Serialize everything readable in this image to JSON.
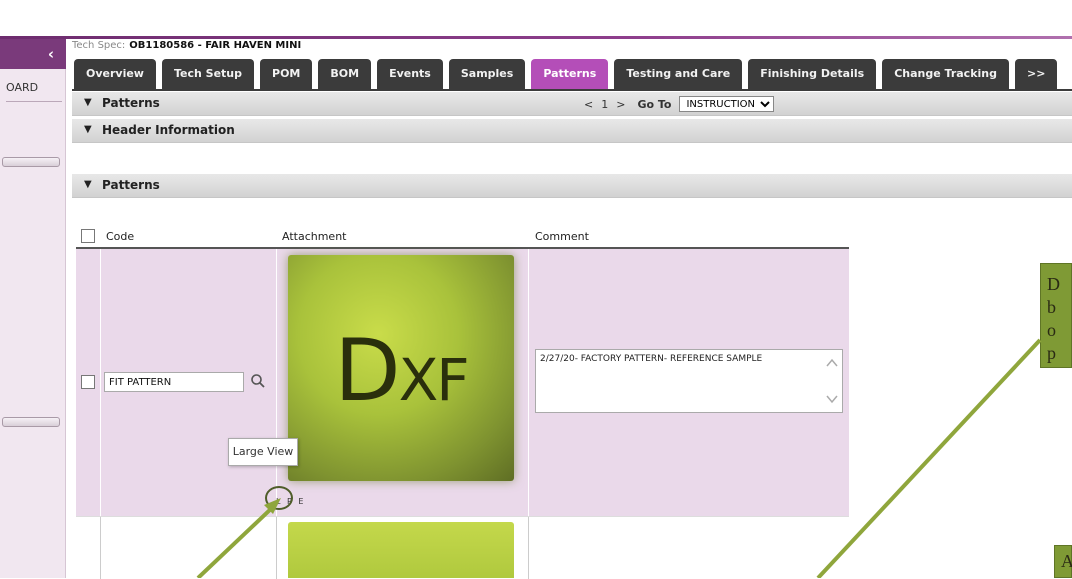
{
  "sidebar": {
    "collapse_glyph": "‹",
    "label": "OARD"
  },
  "header": {
    "techspec_prefix": "Tech Spec:",
    "techspec_value": "OB1180586 - FAIR HAVEN MINI"
  },
  "tabs": [
    {
      "label": "Overview",
      "active": false
    },
    {
      "label": "Tech Setup",
      "active": false
    },
    {
      "label": "POM",
      "active": false
    },
    {
      "label": "BOM",
      "active": false
    },
    {
      "label": "Events",
      "active": false
    },
    {
      "label": "Samples",
      "active": false
    },
    {
      "label": "Patterns",
      "active": true
    },
    {
      "label": "Testing and Care",
      "active": false
    },
    {
      "label": "Finishing Details",
      "active": false
    },
    {
      "label": "Change Tracking",
      "active": false
    },
    {
      "label": ">>",
      "active": false
    }
  ],
  "sections": {
    "patterns_top": "Patterns",
    "header_info": "Header Information",
    "patterns_list": "Patterns"
  },
  "pager": {
    "prev": "<",
    "page": "1",
    "next": ">",
    "goto_label": "Go To",
    "goto_value": "INSTRUCTION"
  },
  "table": {
    "columns": [
      "Code",
      "Attachment",
      "Comment"
    ],
    "rows": [
      {
        "code": "FIT PATTERN",
        "attachment_icon_big": "D",
        "attachment_icon_small": "XF",
        "attachment_actions": "L P E",
        "comment": "2/27/20- FACTORY PATTERN- REFERENCE SAMPLE"
      }
    ]
  },
  "tooltip": "Large View",
  "callouts": {
    "right_top_letters": [
      "D",
      "b",
      "o",
      "p"
    ],
    "right_bottom_letter": "A"
  },
  "colors": {
    "active_tab": "#b44eb8",
    "tab": "#3b3b3b",
    "row_highlight": "#ead9ea",
    "callout_green": "#7f9a35"
  }
}
